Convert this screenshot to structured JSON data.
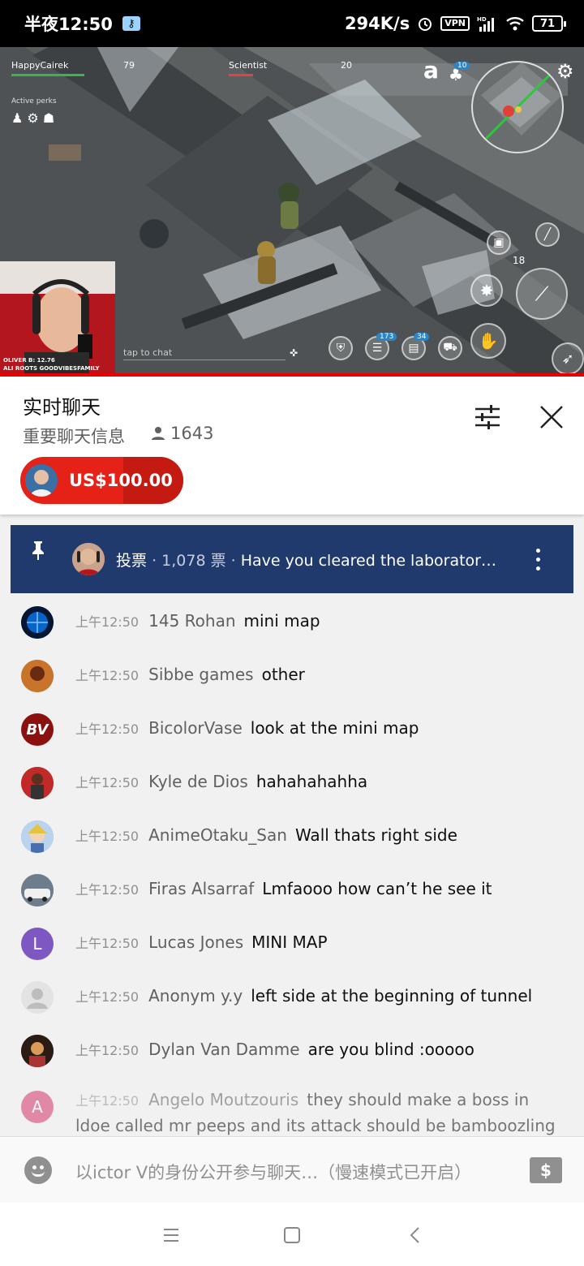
{
  "status_bar": {
    "time": "半夜12:50",
    "network_speed": "294K/s",
    "vpn": "VPN",
    "signal": "HD",
    "battery": "71"
  },
  "video": {
    "player_left_name": "HappyCairek",
    "player_left_value": "79",
    "player_right_name": "Scientist",
    "player_right_value": "20",
    "perks_label": "Active perks",
    "tap_to_chat": "tap to chat",
    "badge_10": "10",
    "badge_18": "18",
    "badge_173": "173",
    "badge_34": "34",
    "cam_line1": "OLIVER B: 12.76",
    "cam_line2": "ALI ROOTS GOODVIBESFAMILY"
  },
  "chat_header": {
    "title": "实时聊天",
    "subtitle": "重要聊天信息",
    "viewer_count": "1643",
    "superchat_amount": "US$100.00"
  },
  "pinned": {
    "label": "投票",
    "votes": "1,078 票",
    "question": "Have you cleared the laborator…"
  },
  "messages": [
    {
      "time": "上午12:50",
      "author": "145 Rohan",
      "text": "mini map",
      "avatar_color": "#0a64c8",
      "initial": ""
    },
    {
      "time": "上午12:50",
      "author": "Sibbe games",
      "text": "other",
      "avatar_color": "#b05a1a",
      "initial": ""
    },
    {
      "time": "上午12:50",
      "author": "BicolorVase",
      "text": "look at the mini map",
      "avatar_color": "#8b1010",
      "initial": "BV"
    },
    {
      "time": "上午12:50",
      "author": "Kyle de Dios",
      "text": "hahahahahha",
      "avatar_color": "#c22a2a",
      "initial": ""
    },
    {
      "time": "上午12:50",
      "author": "AnimeOtaku_San",
      "text": "Wall thats right side",
      "avatar_color": "#8fb3d6",
      "initial": ""
    },
    {
      "time": "上午12:50",
      "author": "Firas Alsarraf",
      "text": "Lmfaooo how can’t he see it",
      "avatar_color": "#8a8f96",
      "initial": ""
    },
    {
      "time": "上午12:50",
      "author": "Lucas Jones",
      "text": "MINI MAP",
      "avatar_color": "#7e57c2",
      "initial": "L"
    },
    {
      "time": "上午12:50",
      "author": "Anonym y.y",
      "text": "left side at the beginning of tunnel",
      "avatar_color": "#d6d6d6",
      "initial": ""
    },
    {
      "time": "上午12:50",
      "author": "Dylan Van Damme",
      "text": "are you blind :ooooo",
      "avatar_color": "#3a2a20",
      "initial": ""
    },
    {
      "time": "上午12:50",
      "author": "Angelo Moutzouris",
      "text": "they should make a boss in ldoe called mr peeps and its attack should be bamboozling you",
      "avatar_color": "#d6336c",
      "initial": "A"
    }
  ],
  "input": {
    "placeholder": "以ictor V的身份公开参与聊天…（慢速模式已开启）",
    "superchat_glyph": "$"
  },
  "colors": {
    "brand_red": "#e62117",
    "pinned_bg": "#213a6e",
    "chat_bg": "#f1f1f1"
  }
}
